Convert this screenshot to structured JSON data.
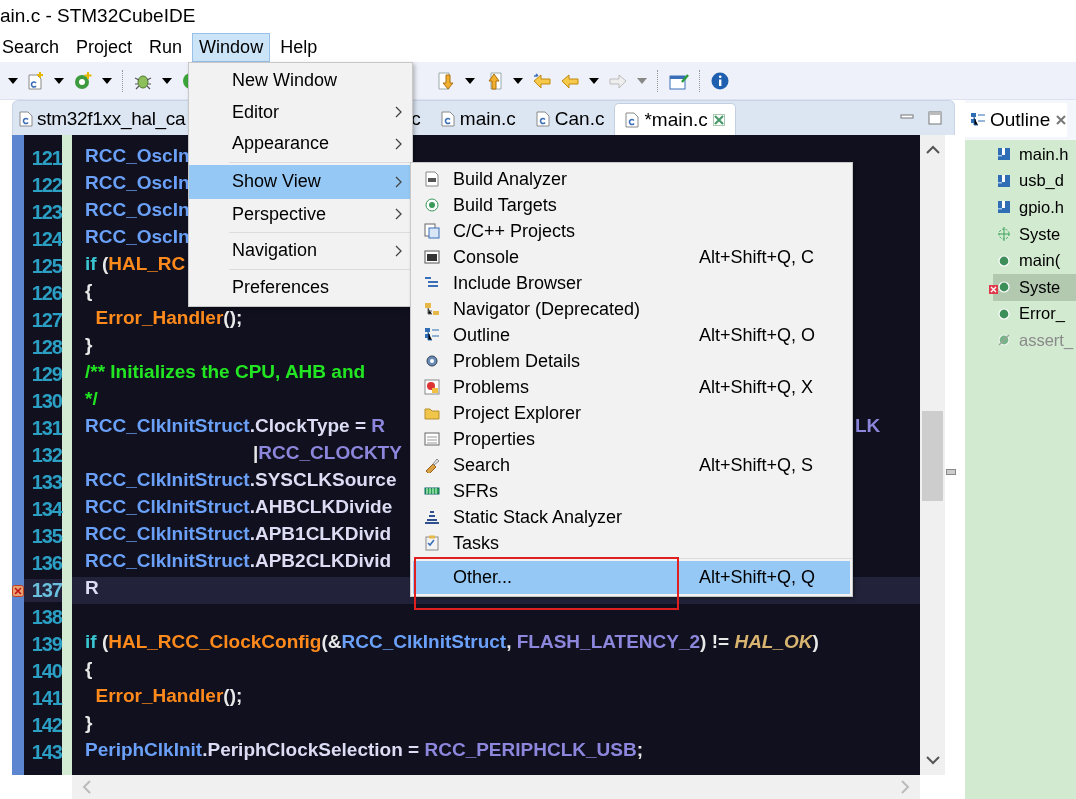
{
  "window": {
    "title": "ain.c - STM32CubeIDE"
  },
  "menu_bar": [
    {
      "label": "Search",
      "selected": false
    },
    {
      "label": "Project",
      "selected": false
    },
    {
      "label": "Run",
      "selected": false
    },
    {
      "label": "Window",
      "selected": true
    },
    {
      "label": "Help",
      "selected": false
    }
  ],
  "editor_tabs": [
    {
      "label": "stm32f1xx_hal_ca",
      "selected": false
    },
    {
      "label": "c",
      "selected": false
    },
    {
      "label": "main.c",
      "selected": false
    },
    {
      "label": "Can.c",
      "selected": false
    },
    {
      "label": "*main.c",
      "selected": true
    }
  ],
  "code_lines": [
    {
      "number": "121",
      "current": false,
      "error": false,
      "segments": [
        {
          "text": "RCC_OscIn",
          "kind": "variable"
        }
      ]
    },
    {
      "number": "122",
      "current": false,
      "error": false,
      "segments": [
        {
          "text": "RCC_OscIn",
          "kind": "variable"
        }
      ]
    },
    {
      "number": "123",
      "current": false,
      "error": false,
      "segments": [
        {
          "text": "RCC_OscIn",
          "kind": "variable"
        }
      ]
    },
    {
      "number": "124",
      "current": false,
      "error": false,
      "segments": [
        {
          "text": "RCC_OscIn",
          "kind": "variable"
        }
      ]
    },
    {
      "number": "125",
      "current": false,
      "error": false,
      "segments": [
        {
          "text": "if",
          "kind": "keyword"
        },
        {
          "text": " (",
          "kind": "punct"
        },
        {
          "text": "HAL_RC",
          "kind": "function"
        }
      ]
    },
    {
      "number": "126",
      "current": false,
      "error": false,
      "segments": [
        {
          "text": "{",
          "kind": "punct"
        }
      ]
    },
    {
      "number": "127",
      "current": false,
      "error": false,
      "segments": [
        {
          "text": "  Error_Handler",
          "kind": "function"
        },
        {
          "text": "();",
          "kind": "punct"
        }
      ]
    },
    {
      "number": "128",
      "current": false,
      "error": false,
      "segments": [
        {
          "text": "}",
          "kind": "punct"
        }
      ]
    },
    {
      "number": "129",
      "current": false,
      "error": false,
      "segments": [
        {
          "text": "/** Initializes the CPU, AHB and",
          "kind": "comment"
        }
      ]
    },
    {
      "number": "130",
      "current": false,
      "error": false,
      "segments": [
        {
          "text": "*/",
          "kind": "comment"
        }
      ]
    },
    {
      "number": "131",
      "current": false,
      "error": false,
      "segments": [
        {
          "text": "RCC_ClkInitStruct",
          "kind": "variable"
        },
        {
          "text": ".ClockType = ",
          "kind": "member"
        },
        {
          "text": "R",
          "kind": "macro"
        }
      ],
      "tail": {
        "text": "LK",
        "kind": "macro"
      }
    },
    {
      "number": "132",
      "current": false,
      "error": false,
      "segments": [
        {
          "text": "\t\t\t\t|",
          "kind": "punct"
        },
        {
          "text": "RCC_CLOCKTY",
          "kind": "macro"
        }
      ]
    },
    {
      "number": "133",
      "current": false,
      "error": false,
      "segments": [
        {
          "text": "RCC_ClkInitStruct",
          "kind": "variable"
        },
        {
          "text": ".SYSCLKSource",
          "kind": "member"
        }
      ]
    },
    {
      "number": "134",
      "current": false,
      "error": false,
      "segments": [
        {
          "text": "RCC_ClkInitStruct",
          "kind": "variable"
        },
        {
          "text": ".AHBCLKDivide",
          "kind": "member"
        }
      ]
    },
    {
      "number": "135",
      "current": false,
      "error": false,
      "segments": [
        {
          "text": "RCC_ClkInitStruct",
          "kind": "variable"
        },
        {
          "text": ".APB1CLKDivid",
          "kind": "member"
        }
      ]
    },
    {
      "number": "136",
      "current": false,
      "error": false,
      "segments": [
        {
          "text": "RCC_ClkInitStruct",
          "kind": "variable"
        },
        {
          "text": ".APB2CLKDivid",
          "kind": "member"
        }
      ]
    },
    {
      "number": "137",
      "current": true,
      "error": true,
      "segments": [
        {
          "text": "R",
          "kind": "member"
        }
      ]
    },
    {
      "number": "138",
      "current": false,
      "error": false
    },
    {
      "number": "139",
      "current": false,
      "error": false,
      "segments": [
        {
          "text": "if",
          "kind": "keyword"
        },
        {
          "text": " (",
          "kind": "punct"
        },
        {
          "text": "HAL_RCC_ClockConfig",
          "kind": "function"
        },
        {
          "text": "(&",
          "kind": "punct"
        },
        {
          "text": "RCC_ClkInitStruct",
          "kind": "variable"
        },
        {
          "text": ", ",
          "kind": "punct"
        },
        {
          "text": "FLASH_LATENCY_2",
          "kind": "macro"
        },
        {
          "text": ") != ",
          "kind": "punct"
        },
        {
          "text": "HAL_OK",
          "kind": "constant"
        },
        {
          "text": ")",
          "kind": "punct"
        }
      ]
    },
    {
      "number": "140",
      "current": false,
      "error": false,
      "segments": [
        {
          "text": "{",
          "kind": "punct"
        }
      ]
    },
    {
      "number": "141",
      "current": false,
      "error": false,
      "segments": [
        {
          "text": "  Error_Handler",
          "kind": "function"
        },
        {
          "text": "();",
          "kind": "punct"
        }
      ]
    },
    {
      "number": "142",
      "current": false,
      "error": false,
      "segments": [
        {
          "text": "}",
          "kind": "punct"
        }
      ]
    },
    {
      "number": "143",
      "current": false,
      "error": false,
      "segments": [
        {
          "text": "PeriphClkInit",
          "kind": "variable"
        },
        {
          "text": ".PeriphClockSelection = ",
          "kind": "member"
        },
        {
          "text": "RCC_PERIPHCLK_USB",
          "kind": "macro"
        },
        {
          "text": ";",
          "kind": "punct"
        }
      ]
    }
  ],
  "outline": {
    "title": "Outline",
    "items": [
      {
        "label": "main.h",
        "kind": "include",
        "selected": false,
        "error": false,
        "disabled": false
      },
      {
        "label": "usb_d",
        "kind": "include",
        "selected": false,
        "error": false,
        "disabled": false
      },
      {
        "label": "gpio.h",
        "kind": "include",
        "selected": false,
        "error": false,
        "disabled": false
      },
      {
        "label": "Syste",
        "kind": "type",
        "selected": false,
        "error": false,
        "disabled": false
      },
      {
        "label": "main(",
        "kind": "function",
        "selected": false,
        "error": false,
        "disabled": false
      },
      {
        "label": "Syste",
        "kind": "function",
        "selected": true,
        "error": true,
        "disabled": false
      },
      {
        "label": "Error_",
        "kind": "function",
        "selected": false,
        "error": false,
        "disabled": false
      },
      {
        "label": "assert_",
        "kind": "function",
        "selected": false,
        "error": false,
        "disabled": true
      }
    ]
  },
  "window_menu": {
    "items": [
      {
        "kind": "item",
        "label": "New Window",
        "submenu": false,
        "selected": false
      },
      {
        "kind": "item",
        "label": "Editor",
        "submenu": true,
        "selected": false
      },
      {
        "kind": "item",
        "label": "Appearance",
        "submenu": true,
        "selected": false
      },
      {
        "kind": "separator"
      },
      {
        "kind": "item",
        "label": "Show View",
        "submenu": true,
        "selected": true
      },
      {
        "kind": "item",
        "label": "Perspective",
        "submenu": true,
        "selected": false
      },
      {
        "kind": "separator"
      },
      {
        "kind": "item",
        "label": "Navigation",
        "submenu": true,
        "selected": false
      },
      {
        "kind": "separator"
      },
      {
        "kind": "item",
        "label": "Preferences",
        "submenu": false,
        "selected": false
      }
    ]
  },
  "show_view_menu": {
    "items": [
      {
        "kind": "item",
        "label": "Build Analyzer",
        "selected": false
      },
      {
        "kind": "item",
        "label": "Build Targets",
        "selected": false
      },
      {
        "kind": "item",
        "label": "C/C++ Projects",
        "selected": false
      },
      {
        "kind": "item",
        "label": "Console",
        "shortcut": "Alt+Shift+Q, C",
        "selected": false
      },
      {
        "kind": "item",
        "label": "Include Browser",
        "selected": false
      },
      {
        "kind": "item",
        "label": "Navigator (Deprecated)",
        "selected": false
      },
      {
        "kind": "item",
        "label": "Outline",
        "shortcut": "Alt+Shift+Q, O",
        "selected": false
      },
      {
        "kind": "item",
        "label": "Problem Details",
        "selected": false
      },
      {
        "kind": "item",
        "label": "Problems",
        "shortcut": "Alt+Shift+Q, X",
        "selected": false
      },
      {
        "kind": "item",
        "label": "Project Explorer",
        "selected": false
      },
      {
        "kind": "item",
        "label": "Properties",
        "selected": false
      },
      {
        "kind": "item",
        "label": "Search",
        "shortcut": "Alt+Shift+Q, S",
        "selected": false
      },
      {
        "kind": "item",
        "label": "SFRs",
        "selected": false
      },
      {
        "kind": "item",
        "label": "Static Stack Analyzer",
        "selected": false
      },
      {
        "kind": "item",
        "label": "Tasks",
        "selected": false
      },
      {
        "kind": "separator"
      },
      {
        "kind": "item",
        "label": "Other...",
        "shortcut": "Alt+Shift+Q, Q",
        "selected": true
      }
    ]
  }
}
